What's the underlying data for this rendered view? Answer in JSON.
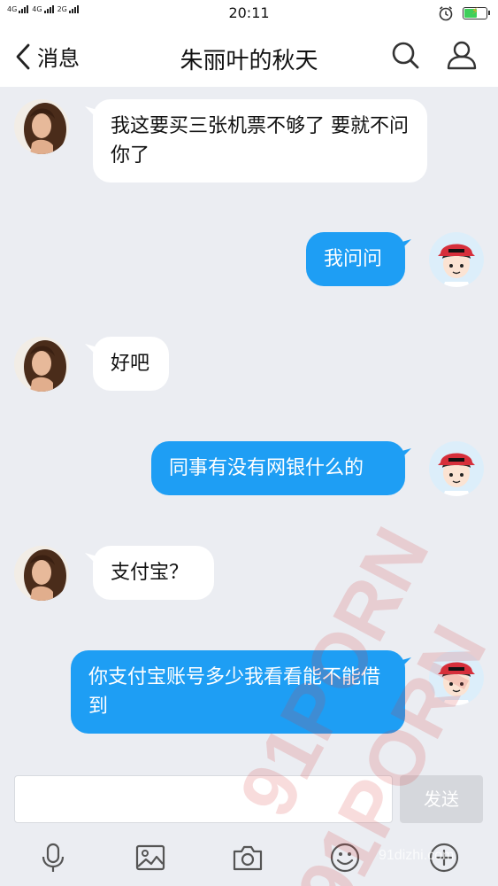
{
  "status_bar": {
    "network_1": "4G",
    "network_2": "4G",
    "network_3": "2G",
    "time": "20:11",
    "icons": [
      "alarm-icon",
      "battery-charging-icon"
    ],
    "battery_level": 0.55
  },
  "header": {
    "back_label": "消息",
    "title": "朱丽叶的秋天",
    "icons": [
      "search-icon",
      "profile-icon"
    ]
  },
  "messages": [
    {
      "side": "in",
      "text": "我这要买三张机票不够了 要就不问你了"
    },
    {
      "side": "out",
      "text": "我问问"
    },
    {
      "side": "in",
      "text": "好吧"
    },
    {
      "side": "out",
      "text": "同事有没有网银什么的"
    },
    {
      "side": "in",
      "text": "支付宝？"
    },
    {
      "side": "out",
      "text": "你支付宝账号多少我看看能不能借到"
    }
  ],
  "input": {
    "value": "",
    "send_label": "发送"
  },
  "toolbar": {
    "icons": [
      "microphone-icon",
      "image-icon",
      "camera-icon",
      "emoji-icon",
      "plus-icon"
    ]
  },
  "watermark": {
    "text": "91PORN",
    "site": "91dizhi.com"
  },
  "colors": {
    "outgoing_bubble": "#1e9ef4",
    "incoming_bubble": "#ffffff",
    "chat_background": "#ebedf2"
  }
}
